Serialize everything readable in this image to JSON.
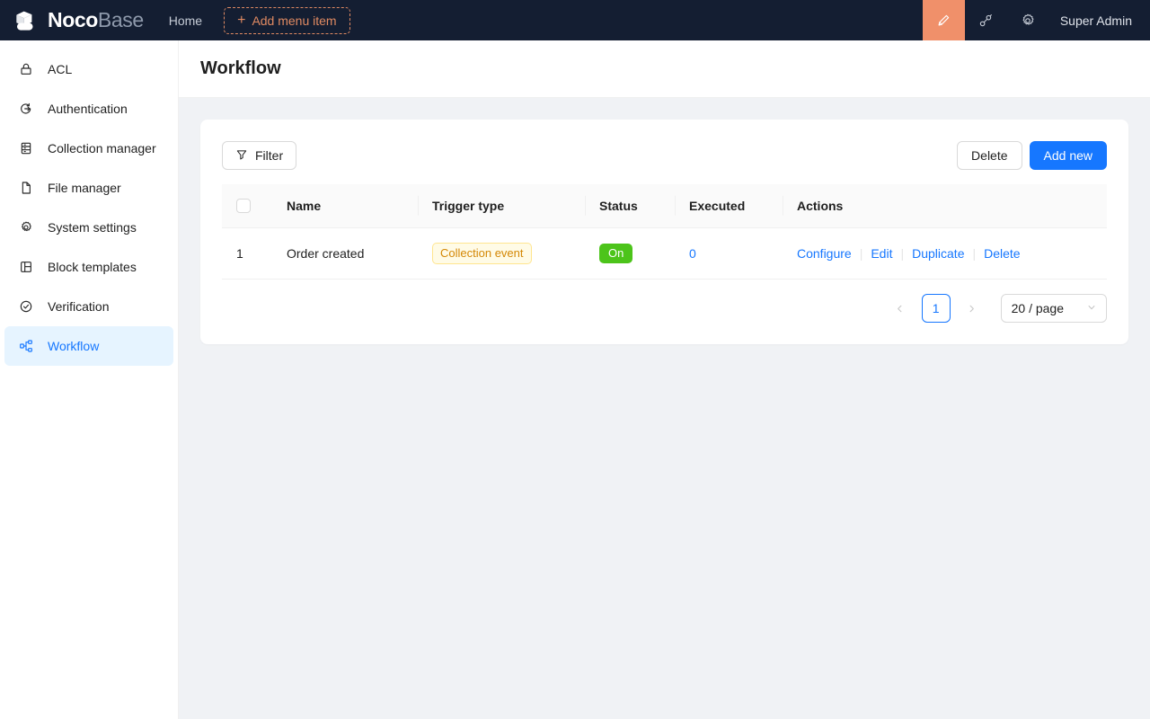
{
  "header": {
    "logo": {
      "icon": "cube-logo-icon",
      "name_primary": "Noco",
      "name_secondary": "Base"
    },
    "nav": [
      {
        "label": "Home",
        "name": "nav-item-home"
      }
    ],
    "add_menu_item": {
      "label": "Add menu item",
      "icon": "plus-icon"
    },
    "icons": [
      {
        "name": "highlighter-icon",
        "highlighted": true
      },
      {
        "name": "plugin-icon",
        "highlighted": false
      },
      {
        "name": "gear-icon",
        "highlighted": false
      }
    ],
    "user": "Super Admin",
    "colors": {
      "background": "#141e32",
      "highlight": "#f0906a",
      "accent_dashed": "#e08a62"
    }
  },
  "sidebar": {
    "items": [
      {
        "label": "ACL",
        "icon": "lock-icon",
        "active": false
      },
      {
        "label": "Authentication",
        "icon": "login-icon",
        "active": false
      },
      {
        "label": "Collection manager",
        "icon": "database-icon",
        "active": false
      },
      {
        "label": "File manager",
        "icon": "file-icon",
        "active": false
      },
      {
        "label": "System settings",
        "icon": "gear-icon",
        "active": false
      },
      {
        "label": "Block templates",
        "icon": "layout-icon",
        "active": false
      },
      {
        "label": "Verification",
        "icon": "check-circle-icon",
        "active": false
      },
      {
        "label": "Workflow",
        "icon": "workflow-nodes-icon",
        "active": true
      }
    ],
    "active_colors": {
      "background": "#e6f4ff",
      "text": "#1677ff"
    }
  },
  "page": {
    "title": "Workflow"
  },
  "toolbar": {
    "filter_label": "Filter",
    "filter_icon": "funnel-icon",
    "delete_label": "Delete",
    "add_new_label": "Add new",
    "primary_color": "#1677ff"
  },
  "table": {
    "columns": [
      "Name",
      "Trigger type",
      "Status",
      "Executed",
      "Actions"
    ],
    "rows": [
      {
        "index": "1",
        "name": "Order created",
        "trigger_type": "Collection event",
        "status": "On",
        "executed": "0",
        "actions": [
          "Configure",
          "Edit",
          "Duplicate",
          "Delete"
        ]
      }
    ],
    "tag_colors": {
      "trigger_bg": "#fffbe6",
      "trigger_border": "#ffe58f",
      "trigger_text": "#d48806",
      "status_on_bg": "#4cc41a"
    }
  },
  "pagination": {
    "prev_icon": "chevron-left-icon",
    "next_icon": "chevron-right-icon",
    "current_page": "1",
    "page_size_label": "20 / page",
    "chevron_icon": "chevron-down-icon"
  }
}
